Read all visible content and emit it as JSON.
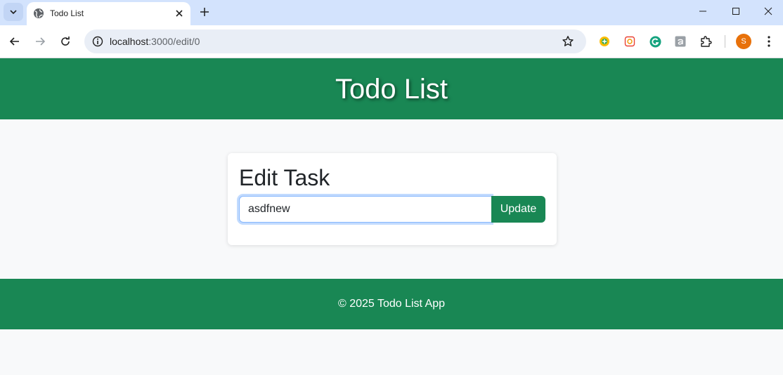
{
  "browser": {
    "tab": {
      "title": "Todo List"
    },
    "address": {
      "host": "localhost",
      "path": ":3000/edit/0"
    },
    "profile_initial": "S"
  },
  "page": {
    "header_title": "Todo List",
    "card": {
      "title": "Edit Task",
      "input_value": "asdfnew",
      "update_label": "Update"
    },
    "footer_text": "© 2025 Todo List App"
  },
  "colors": {
    "brand_green": "#198754",
    "page_background": "#f8f9fa",
    "tab_strip": "#d3e3fd"
  },
  "icons": [
    "tab-search-icon",
    "globe-icon",
    "close-icon",
    "plus-icon",
    "minimize-icon",
    "maximize-icon",
    "window-close-icon",
    "back-arrow-icon",
    "forward-arrow-icon",
    "reload-icon",
    "site-info-icon",
    "star-icon",
    "extension-icon",
    "puzzle-icon",
    "kebab-menu-icon"
  ]
}
